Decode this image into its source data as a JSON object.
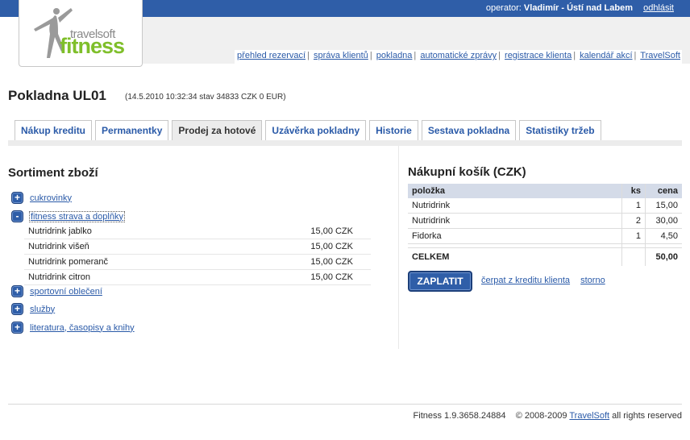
{
  "header": {
    "operator_label": "operator:",
    "operator_name": "Vladimír - Ústí nad Labem",
    "logout": "odhlásit",
    "logo_brand_small": "travelsoft",
    "logo_brand_big": "fitness"
  },
  "nav": [
    "přehled rezervací",
    "správa klientů",
    "pokladna",
    "automatické zprávy",
    "registrace klienta",
    "kalendář akcí",
    "TravelSoft"
  ],
  "page": {
    "title": "Pokladna UL01",
    "subtitle": "(14.5.2010 10:32:34 stav 34833 CZK 0 EUR)"
  },
  "tabs": [
    {
      "label": "Nákup kreditu"
    },
    {
      "label": "Permanentky"
    },
    {
      "label": "Prodej za hotové"
    },
    {
      "label": "Uzávěrka pokladny"
    },
    {
      "label": "Historie"
    },
    {
      "label": "Sestava pokladna"
    },
    {
      "label": "Statistiky tržeb"
    }
  ],
  "assortment": {
    "title": "Sortiment zboží",
    "categories": [
      {
        "label": "cukrovinky",
        "icon": "+"
      },
      {
        "label": "fitness strava a doplňky",
        "icon": "-"
      },
      {
        "label": "sportovní oblečení",
        "icon": "+"
      },
      {
        "label": "služby",
        "icon": "+"
      },
      {
        "label": "literatura, časopisy a knihy",
        "icon": "+"
      }
    ],
    "items": [
      {
        "name": "Nutridrink  jablko",
        "price": "15,00 CZK"
      },
      {
        "name": "Nutridrink  višeň",
        "price": "15,00 CZK"
      },
      {
        "name": "Nutridrink  pomeranč",
        "price": "15,00 CZK"
      },
      {
        "name": "Nutridrink  citron",
        "price": "15,00 CZK"
      }
    ]
  },
  "cart": {
    "title": "Nákupní košík (CZK)",
    "headers": {
      "item": "položka",
      "qty": "ks",
      "price": "cena"
    },
    "rows": [
      {
        "item": "Nutridrink",
        "qty": "1",
        "price": "15,00"
      },
      {
        "item": "Nutridrink",
        "qty": "2",
        "price": "30,00"
      },
      {
        "item": "Fidorka",
        "qty": "1",
        "price": "4,50"
      }
    ],
    "total_label": "CELKEM",
    "total_value": "50,00",
    "pay_button": "ZAPLATIT",
    "credit_link": "čerpat z kreditu klienta",
    "cancel_link": "storno"
  },
  "footer": {
    "version": "Fitness 1.9.3658.24884",
    "copyright": "© 2008-2009",
    "company": "TravelSoft",
    "rights": "all rights reserved"
  },
  "colors": {
    "primary": "#2f5ea8",
    "logo_green": "#7fbf2a",
    "tab_active_bg": "#ececec"
  }
}
